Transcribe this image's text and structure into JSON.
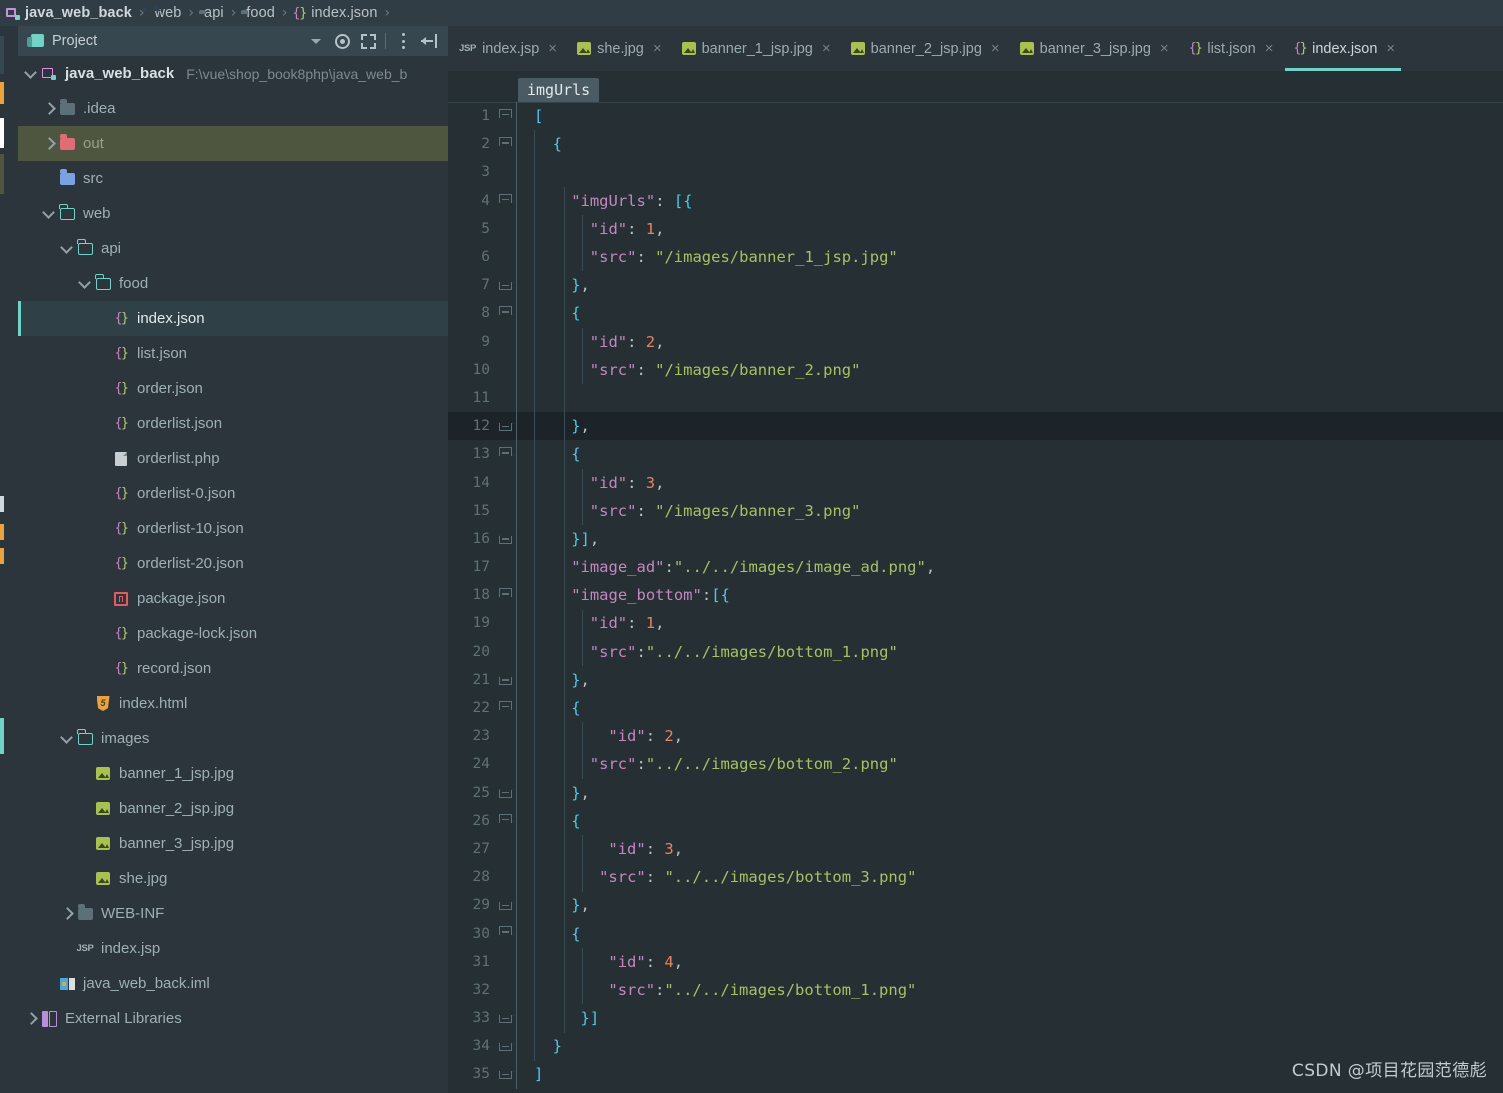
{
  "breadcrumb": {
    "items": [
      {
        "label": "java_web_back",
        "icon": "module-icon"
      },
      {
        "label": "web",
        "icon": "folder-image-icon"
      },
      {
        "label": "api",
        "icon": "folder-icon"
      },
      {
        "label": "food",
        "icon": "folder-icon"
      },
      {
        "label": "index.json",
        "icon": "json-icon"
      }
    ],
    "separator": "›"
  },
  "project_panel": {
    "title": "Project",
    "tools": [
      {
        "name": "chevron-down-icon"
      },
      {
        "name": "locate-target-icon"
      },
      {
        "name": "collapse-all-icon"
      },
      {
        "name": "more-options-icon"
      },
      {
        "name": "hide-panel-icon"
      }
    ],
    "tree": [
      {
        "label": "java_web_back",
        "sublabel": "F:\\vue\\shop_book8php\\java_web_b",
        "icon": "module-icon",
        "arrow": "down",
        "indent": 0,
        "state": "root"
      },
      {
        "label": ".idea",
        "icon": "folder-gray-icon",
        "arrow": "right",
        "indent": 1,
        "state": ""
      },
      {
        "label": "out",
        "icon": "folder-red-icon",
        "arrow": "right",
        "indent": 1,
        "state": "excluded"
      },
      {
        "label": "src",
        "icon": "folder-blue-icon",
        "arrow": "none",
        "indent": 1,
        "state": ""
      },
      {
        "label": "web",
        "icon": "folder-teal-icon",
        "arrow": "down",
        "indent": 1,
        "state": ""
      },
      {
        "label": "api",
        "icon": "folder-teal-icon",
        "arrow": "down",
        "indent": 2,
        "state": ""
      },
      {
        "label": "food",
        "icon": "folder-teal-icon",
        "arrow": "down",
        "indent": 3,
        "state": ""
      },
      {
        "label": "index.json",
        "icon": "json-icon",
        "arrow": "none",
        "indent": 4,
        "state": "selected"
      },
      {
        "label": "list.json",
        "icon": "json-icon",
        "arrow": "none",
        "indent": 4,
        "state": ""
      },
      {
        "label": "order.json",
        "icon": "json-icon",
        "arrow": "none",
        "indent": 4,
        "state": ""
      },
      {
        "label": "orderlist.json",
        "icon": "json-icon",
        "arrow": "none",
        "indent": 4,
        "state": ""
      },
      {
        "label": "orderlist.php",
        "icon": "php-file-icon",
        "arrow": "none",
        "indent": 4,
        "state": ""
      },
      {
        "label": "orderlist-0.json",
        "icon": "json-icon",
        "arrow": "none",
        "indent": 4,
        "state": ""
      },
      {
        "label": "orderlist-10.json",
        "icon": "json-icon",
        "arrow": "none",
        "indent": 4,
        "state": ""
      },
      {
        "label": "orderlist-20.json",
        "icon": "json-icon",
        "arrow": "none",
        "indent": 4,
        "state": ""
      },
      {
        "label": "package.json",
        "icon": "npm-icon",
        "arrow": "none",
        "indent": 4,
        "state": ""
      },
      {
        "label": "package-lock.json",
        "icon": "json-icon",
        "arrow": "none",
        "indent": 4,
        "state": ""
      },
      {
        "label": "record.json",
        "icon": "json-icon",
        "arrow": "none",
        "indent": 4,
        "state": ""
      },
      {
        "label": "index.html",
        "icon": "html-icon",
        "arrow": "none",
        "indent": 3,
        "state": ""
      },
      {
        "label": "images",
        "icon": "folder-teal-icon",
        "arrow": "down",
        "indent": 2,
        "state": ""
      },
      {
        "label": "banner_1_jsp.jpg",
        "icon": "image-icon",
        "arrow": "none",
        "indent": 3,
        "state": ""
      },
      {
        "label": "banner_2_jsp.jpg",
        "icon": "image-icon",
        "arrow": "none",
        "indent": 3,
        "state": ""
      },
      {
        "label": "banner_3_jsp.jpg",
        "icon": "image-icon",
        "arrow": "none",
        "indent": 3,
        "state": ""
      },
      {
        "label": "she.jpg",
        "icon": "image-icon",
        "arrow": "none",
        "indent": 3,
        "state": ""
      },
      {
        "label": "WEB-INF",
        "icon": "folder-gray-icon",
        "arrow": "right",
        "indent": 2,
        "state": ""
      },
      {
        "label": "index.jsp",
        "icon": "jsp-icon",
        "arrow": "none",
        "indent": 2,
        "state": ""
      },
      {
        "label": "java_web_back.iml",
        "icon": "iml-icon",
        "arrow": "none",
        "indent": 1,
        "state": ""
      },
      {
        "label": "External Libraries",
        "icon": "library-icon",
        "arrow": "right",
        "indent": 0,
        "state": ""
      }
    ]
  },
  "editor_tabs": {
    "close_glyph": "×",
    "items": [
      {
        "label": "index.jsp",
        "icon": "jsp-icon",
        "active": false
      },
      {
        "label": "she.jpg",
        "icon": "image-icon",
        "active": false
      },
      {
        "label": "banner_1_jsp.jpg",
        "icon": "image-icon",
        "active": false
      },
      {
        "label": "banner_2_jsp.jpg",
        "icon": "image-icon",
        "active": false
      },
      {
        "label": "banner_3_jsp.jpg",
        "icon": "image-icon",
        "active": false
      },
      {
        "label": "list.json",
        "icon": "json-icon",
        "active": false
      },
      {
        "label": "index.json",
        "icon": "json-icon",
        "active": true
      }
    ]
  },
  "editor": {
    "structure_crumb": "imgUrls",
    "caret_line": 12,
    "lines": [
      {
        "num": 1,
        "fold": "open",
        "indent": 0,
        "tokens": [
          {
            "t": "[",
            "c": "p"
          }
        ]
      },
      {
        "num": 2,
        "fold": "open",
        "indent": 1,
        "tokens": [
          {
            "t": "{",
            "c": "p"
          }
        ]
      },
      {
        "num": 3,
        "fold": "none",
        "indent": 0,
        "tokens": []
      },
      {
        "num": 4,
        "fold": "open",
        "indent": 2,
        "tokens": [
          {
            "t": "\"imgUrls\"",
            "c": "k"
          },
          {
            "t": ": ",
            "c": "d"
          },
          {
            "t": "[{",
            "c": "p"
          }
        ]
      },
      {
        "num": 5,
        "fold": "none",
        "indent": 3,
        "tokens": [
          {
            "t": "\"id\"",
            "c": "k"
          },
          {
            "t": ": ",
            "c": "d"
          },
          {
            "t": "1",
            "c": "n"
          },
          {
            "t": ",",
            "c": "d"
          }
        ]
      },
      {
        "num": 6,
        "fold": "none",
        "indent": 3,
        "tokens": [
          {
            "t": "\"src\"",
            "c": "k"
          },
          {
            "t": ": ",
            "c": "d"
          },
          {
            "t": "\"/images/banner_1_jsp.jpg\"",
            "c": "s"
          }
        ]
      },
      {
        "num": 7,
        "fold": "close",
        "indent": 2,
        "tokens": [
          {
            "t": "}",
            "c": "p"
          },
          {
            "t": ",",
            "c": "d"
          }
        ]
      },
      {
        "num": 8,
        "fold": "open",
        "indent": 2,
        "tokens": [
          {
            "t": "{",
            "c": "p"
          }
        ]
      },
      {
        "num": 9,
        "fold": "none",
        "indent": 3,
        "tokens": [
          {
            "t": "\"id\"",
            "c": "k"
          },
          {
            "t": ": ",
            "c": "d"
          },
          {
            "t": "2",
            "c": "n"
          },
          {
            "t": ",",
            "c": "d"
          }
        ]
      },
      {
        "num": 10,
        "fold": "none",
        "indent": 3,
        "tokens": [
          {
            "t": "\"src\"",
            "c": "k"
          },
          {
            "t": ": ",
            "c": "d"
          },
          {
            "t": "\"/images/banner_2.png\"",
            "c": "s"
          }
        ]
      },
      {
        "num": 11,
        "fold": "none",
        "indent": 0,
        "tokens": []
      },
      {
        "num": 12,
        "fold": "close",
        "indent": 2,
        "tokens": [
          {
            "t": "}",
            "c": "p"
          },
          {
            "t": ",",
            "c": "d"
          }
        ]
      },
      {
        "num": 13,
        "fold": "open",
        "indent": 2,
        "tokens": [
          {
            "t": "{",
            "c": "p"
          }
        ]
      },
      {
        "num": 14,
        "fold": "none",
        "indent": 3,
        "tokens": [
          {
            "t": "\"id\"",
            "c": "k"
          },
          {
            "t": ": ",
            "c": "d"
          },
          {
            "t": "3",
            "c": "n"
          },
          {
            "t": ",",
            "c": "d"
          }
        ]
      },
      {
        "num": 15,
        "fold": "none",
        "indent": 3,
        "tokens": [
          {
            "t": "\"src\"",
            "c": "k"
          },
          {
            "t": ": ",
            "c": "d"
          },
          {
            "t": "\"/images/banner_3.png\"",
            "c": "s"
          }
        ]
      },
      {
        "num": 16,
        "fold": "close",
        "indent": 2,
        "tokens": [
          {
            "t": "}]",
            "c": "p"
          },
          {
            "t": ",",
            "c": "d"
          }
        ]
      },
      {
        "num": 17,
        "fold": "none",
        "indent": 2,
        "tokens": [
          {
            "t": "\"image_ad\"",
            "c": "k"
          },
          {
            "t": ":",
            "c": "d"
          },
          {
            "t": "\"../../images/image_ad.png\"",
            "c": "s"
          },
          {
            "t": ",",
            "c": "d"
          }
        ]
      },
      {
        "num": 18,
        "fold": "open",
        "indent": 2,
        "tokens": [
          {
            "t": "\"image_bottom\"",
            "c": "k"
          },
          {
            "t": ":",
            "c": "d"
          },
          {
            "t": "[{",
            "c": "p"
          }
        ]
      },
      {
        "num": 19,
        "fold": "none",
        "indent": 3,
        "tokens": [
          {
            "t": "\"id\"",
            "c": "k"
          },
          {
            "t": ": ",
            "c": "d"
          },
          {
            "t": "1",
            "c": "n"
          },
          {
            "t": ",",
            "c": "d"
          }
        ]
      },
      {
        "num": 20,
        "fold": "none",
        "indent": 3,
        "tokens": [
          {
            "t": "\"src\"",
            "c": "k"
          },
          {
            "t": ":",
            "c": "d"
          },
          {
            "t": "\"../../images/bottom_1.png\"",
            "c": "s"
          }
        ]
      },
      {
        "num": 21,
        "fold": "close",
        "indent": 2,
        "tokens": [
          {
            "t": "}",
            "c": "p"
          },
          {
            "t": ",",
            "c": "d"
          }
        ]
      },
      {
        "num": 22,
        "fold": "open",
        "indent": 2,
        "tokens": [
          {
            "t": "{",
            "c": "p"
          }
        ]
      },
      {
        "num": 23,
        "fold": "none",
        "indent": 4,
        "tokens": [
          {
            "t": "\"id\"",
            "c": "k"
          },
          {
            "t": ": ",
            "c": "d"
          },
          {
            "t": "2",
            "c": "n"
          },
          {
            "t": ",",
            "c": "d"
          }
        ]
      },
      {
        "num": 24,
        "fold": "none",
        "indent": 3,
        "tokens": [
          {
            "t": "\"src\"",
            "c": "k"
          },
          {
            "t": ":",
            "c": "d"
          },
          {
            "t": "\"../../images/bottom_2.png\"",
            "c": "s"
          }
        ]
      },
      {
        "num": 25,
        "fold": "close",
        "indent": 2,
        "tokens": [
          {
            "t": "}",
            "c": "p"
          },
          {
            "t": ",",
            "c": "d"
          }
        ]
      },
      {
        "num": 26,
        "fold": "open",
        "indent": 2,
        "tokens": [
          {
            "t": "{",
            "c": "p"
          }
        ]
      },
      {
        "num": 27,
        "fold": "none",
        "indent": 4,
        "tokens": [
          {
            "t": "\"id\"",
            "c": "k"
          },
          {
            "t": ": ",
            "c": "d"
          },
          {
            "t": "3",
            "c": "n"
          },
          {
            "t": ",",
            "c": "d"
          }
        ]
      },
      {
        "num": 28,
        "fold": "none",
        "indent": 3.5,
        "tokens": [
          {
            "t": "\"src\"",
            "c": "k"
          },
          {
            "t": ": ",
            "c": "d"
          },
          {
            "t": "\"../../images/bottom_3.png\"",
            "c": "s"
          }
        ]
      },
      {
        "num": 29,
        "fold": "close",
        "indent": 2,
        "tokens": [
          {
            "t": "}",
            "c": "p"
          },
          {
            "t": ",",
            "c": "d"
          }
        ]
      },
      {
        "num": 30,
        "fold": "open",
        "indent": 2,
        "tokens": [
          {
            "t": "{",
            "c": "p"
          }
        ]
      },
      {
        "num": 31,
        "fold": "none",
        "indent": 4,
        "tokens": [
          {
            "t": "\"id\"",
            "c": "k"
          },
          {
            "t": ": ",
            "c": "d"
          },
          {
            "t": "4",
            "c": "n"
          },
          {
            "t": ",",
            "c": "d"
          }
        ]
      },
      {
        "num": 32,
        "fold": "none",
        "indent": 4,
        "tokens": [
          {
            "t": "\"src\"",
            "c": "k"
          },
          {
            "t": ":",
            "c": "d"
          },
          {
            "t": "\"../../images/bottom_1.png\"",
            "c": "s"
          }
        ]
      },
      {
        "num": 33,
        "fold": "close",
        "indent": 2.5,
        "tokens": [
          {
            "t": "}]",
            "c": "p"
          }
        ]
      },
      {
        "num": 34,
        "fold": "close",
        "indent": 1,
        "tokens": [
          {
            "t": "}",
            "c": "p"
          }
        ]
      },
      {
        "num": 35,
        "fold": "close",
        "indent": 0,
        "tokens": [
          {
            "t": "]",
            "c": "p"
          }
        ]
      }
    ]
  },
  "watermark": {
    "text": "CSDN @项目花园范德彪"
  },
  "colors": {
    "editor_bg": "#262f34",
    "panel_bg": "#2b353b",
    "header_bg": "#37474f",
    "accent": "#6fd3c7",
    "caret_line": "#1d2429",
    "selection": "#2f4146",
    "excluded": "#4e5640",
    "key": "#c586c0",
    "string": "#a5c261",
    "number": "#e8825f",
    "punct": "#4ec9e8"
  }
}
